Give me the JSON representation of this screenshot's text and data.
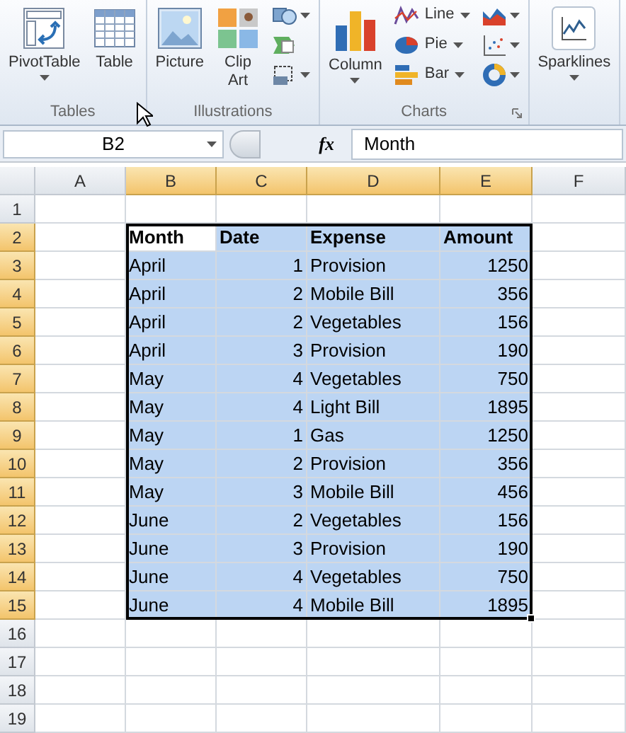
{
  "ribbon": {
    "groups": [
      {
        "label": "Tables",
        "launcher": false,
        "columns": [
          [
            {
              "kind": "large",
              "label": "PivotTable",
              "dropdown": true
            }
          ],
          [
            {
              "kind": "large",
              "label": "Table",
              "dropdown": false
            }
          ]
        ]
      },
      {
        "label": "Illustrations",
        "launcher": false,
        "columns": [
          [
            {
              "kind": "large",
              "label": "Picture",
              "dropdown": false
            }
          ],
          [
            {
              "kind": "large",
              "label": "Clip Art",
              "dropdown": false
            }
          ],
          [
            {
              "kind": "icon",
              "dropdown": true
            },
            {
              "kind": "icon",
              "dropdown": false
            },
            {
              "kind": "icon",
              "dropdown": true
            }
          ]
        ]
      },
      {
        "label": "Charts",
        "launcher": true,
        "columns": [
          [
            {
              "kind": "large",
              "label": "Column",
              "dropdown": true
            }
          ],
          [
            {
              "kind": "small",
              "label": "Line",
              "dropdown": true
            },
            {
              "kind": "small",
              "label": "Pie",
              "dropdown": true
            },
            {
              "kind": "small",
              "label": "Bar",
              "dropdown": true
            }
          ],
          [
            {
              "kind": "icon",
              "dropdown": true
            },
            {
              "kind": "icon",
              "dropdown": true
            },
            {
              "kind": "icon",
              "dropdown": true
            }
          ]
        ]
      },
      {
        "launcher": false,
        "columns": [
          [
            {
              "kind": "large",
              "label": "Sparklines",
              "dropdown": true
            }
          ]
        ]
      }
    ]
  },
  "formula_bar": {
    "name_box": "B2",
    "fx": "fx",
    "formula": "Month"
  },
  "sheet": {
    "columns": [
      {
        "label": "A",
        "selected": false
      },
      {
        "label": "B",
        "selected": true
      },
      {
        "label": "C",
        "selected": true
      },
      {
        "label": "D",
        "selected": true
      },
      {
        "label": "E",
        "selected": true
      },
      {
        "label": "F",
        "selected": false
      }
    ],
    "rows": [
      {
        "label": "1",
        "selected": false
      },
      {
        "label": "2",
        "selected": true
      },
      {
        "label": "3",
        "selected": true
      },
      {
        "label": "4",
        "selected": true
      },
      {
        "label": "5",
        "selected": true
      },
      {
        "label": "6",
        "selected": true
      },
      {
        "label": "7",
        "selected": true
      },
      {
        "label": "8",
        "selected": true
      },
      {
        "label": "9",
        "selected": true
      },
      {
        "label": "10",
        "selected": true
      },
      {
        "label": "11",
        "selected": true
      },
      {
        "label": "12",
        "selected": true
      },
      {
        "label": "13",
        "selected": true
      },
      {
        "label": "14",
        "selected": true
      },
      {
        "label": "15",
        "selected": true
      },
      {
        "label": "16",
        "selected": false
      },
      {
        "label": "17",
        "selected": false
      },
      {
        "label": "18",
        "selected": false
      },
      {
        "label": "19",
        "selected": false
      }
    ]
  },
  "table": {
    "header": [
      {
        "text": "Month",
        "active": true
      },
      {
        "text": "Date",
        "active": false
      },
      {
        "text": "Expense",
        "active": false
      },
      {
        "text": "Amount",
        "active": false
      }
    ],
    "rows": [
      [
        "April",
        "1",
        "Provision",
        "1250"
      ],
      [
        "April",
        "2",
        "Mobile Bill",
        "356"
      ],
      [
        "April",
        "2",
        "Vegetables",
        "156"
      ],
      [
        "April",
        "3",
        "Provision",
        "190"
      ],
      [
        "May",
        "4",
        "Vegetables",
        "750"
      ],
      [
        "May",
        "4",
        "Light Bill",
        "1895"
      ],
      [
        "May",
        "1",
        "Gas",
        "1250"
      ],
      [
        "May",
        "2",
        "Provision",
        "356"
      ],
      [
        "May",
        "3",
        "Mobile Bill",
        "456"
      ],
      [
        "June",
        "2",
        "Vegetables",
        "156"
      ],
      [
        "June",
        "3",
        "Provision",
        "190"
      ],
      [
        "June",
        "4",
        "Vegetables",
        "750"
      ],
      [
        "June",
        "4",
        "Mobile Bill",
        "1895"
      ]
    ]
  }
}
